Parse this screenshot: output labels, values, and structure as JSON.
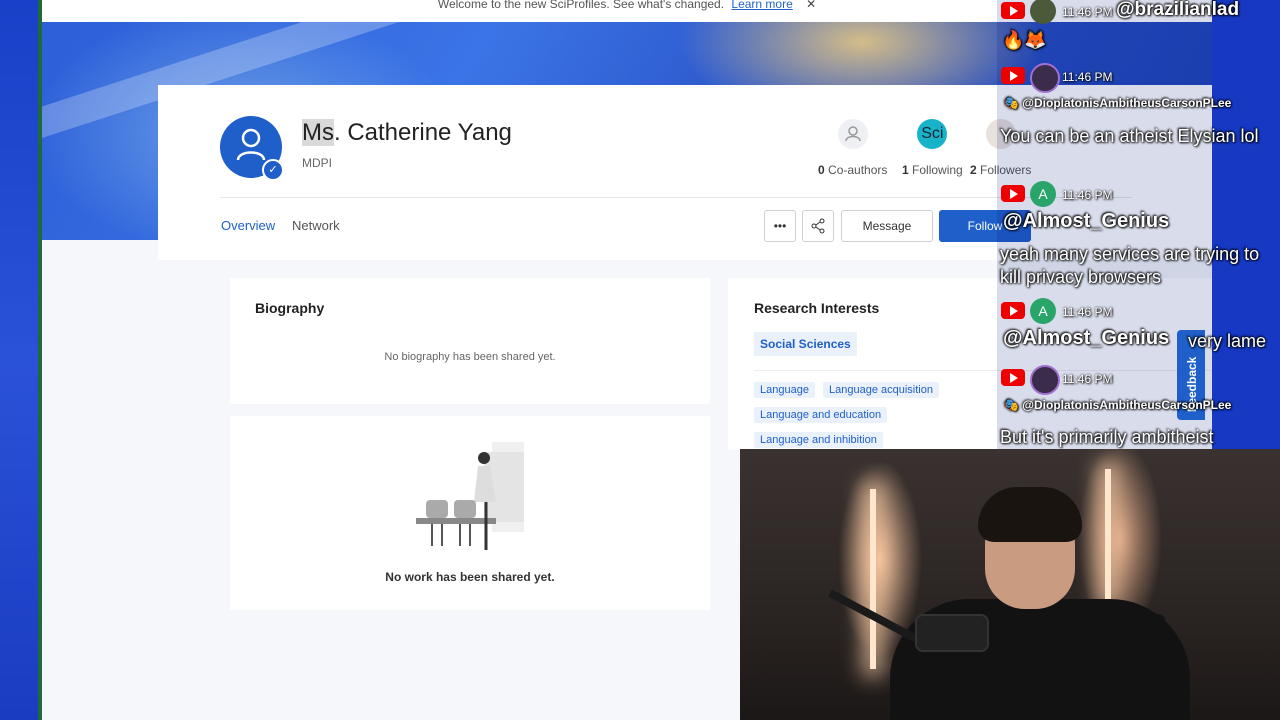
{
  "banner": {
    "text": "Welcome to the new SciProfiles. See what's changed.",
    "link": "Learn more",
    "close": "✕"
  },
  "profile": {
    "title": "Ms",
    "name_rest": ". Catherine Yang",
    "affiliation": "MDPI",
    "stats": [
      {
        "count": "0",
        "label": "Co-authors"
      },
      {
        "count": "1",
        "label": "Following",
        "icon_text": "Sci"
      },
      {
        "count": "2",
        "label": "Followers"
      }
    ]
  },
  "tabs": {
    "overview": "Overview",
    "network": "Network"
  },
  "actions": {
    "more": "•••",
    "message": "Message",
    "follow": "Follow"
  },
  "biography": {
    "title": "Biography",
    "empty": "No biography has been shared yet."
  },
  "works": {
    "empty": "No work has been shared yet."
  },
  "research": {
    "title": "Research Interests",
    "primary": "Social Sciences",
    "tags": [
      "Language",
      "Language acquisition",
      "Language and education",
      "Language and inhibition"
    ]
  },
  "feedback": "Feedback",
  "chat": [
    {
      "time": "11:46 PM",
      "user": "@brazilianlad",
      "emoji": "🔥🦊"
    },
    {
      "time": "11:46 PM",
      "user": "@DioplatonisAmbitheusCarsonPLee",
      "message": "You can be an atheist Elysian lol"
    },
    {
      "time": "11:46 PM",
      "avatar_letter": "A",
      "user": "@Almost_Genius",
      "message": "yeah many services are trying to kill privacy browsers"
    },
    {
      "time": "11:46 PM",
      "avatar_letter": "A",
      "user": "@Almost_Genius",
      "message": "very lame"
    },
    {
      "time": "11:46 PM",
      "user": "@DioplatonisAmbitheusCarsonPLee",
      "message": "But it's primarily ambitheist"
    }
  ],
  "colors": {
    "brand": "#1f5fc9",
    "youtube": "#ee0000"
  }
}
